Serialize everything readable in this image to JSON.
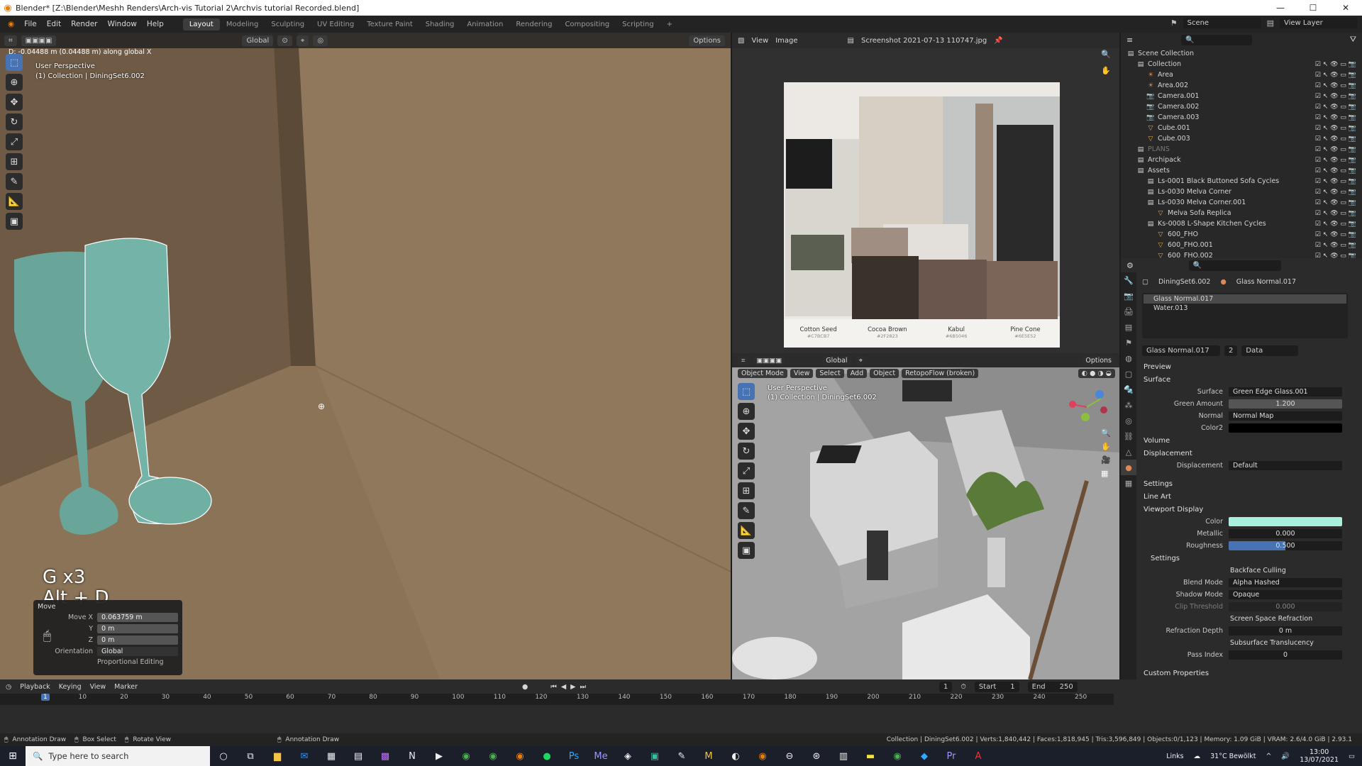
{
  "window": {
    "title": "Blender* [Z:\\Blender\\Meshh Renders\\Arch-vis Tutorial 2\\Archvis tutorial Recorded.blend]"
  },
  "menu": [
    "File",
    "Edit",
    "Render",
    "Window",
    "Help"
  ],
  "workspaces": [
    "Layout",
    "Modeling",
    "Sculpting",
    "UV Editing",
    "Texture Paint",
    "Shading",
    "Animation",
    "Rendering",
    "Compositing",
    "Scripting"
  ],
  "active_workspace": "Layout",
  "scene": "Scene",
  "view_layer": "View Layer",
  "viewport": {
    "header_status": "D: -0.04488 m (0.04488 m) along global X",
    "orientation": "Global",
    "options_label": "Options",
    "perspective": "User Perspective",
    "collection": "(1) Collection | DiningSet6.002",
    "keys_line1": "G x3",
    "keys_line2": "Alt + D"
  },
  "move_panel": {
    "title": "Move",
    "rows": [
      {
        "label": "Move X",
        "value": "0.063759 m"
      },
      {
        "label": "Y",
        "value": "0 m"
      },
      {
        "label": "Z",
        "value": "0 m"
      }
    ],
    "orientation_label": "Orientation",
    "orientation_value": "Global",
    "proportional": "Proportional Editing"
  },
  "image_editor": {
    "view": "View",
    "image": "Image",
    "filename": "Screenshot 2021-07-13 110747.jpg",
    "swatches": [
      {
        "name": "Cotton Seed",
        "code": "#C7BCB7",
        "color": "#5a5f52"
      },
      {
        "name": "Cocoa Brown",
        "code": "#2F2823",
        "color": "#3a312b"
      },
      {
        "name": "Kabul",
        "code": "#6B5046",
        "color": "#6b564d"
      },
      {
        "name": "Pine Cone",
        "code": "#6E5E52",
        "color": "#7a6558"
      }
    ]
  },
  "viewport2": {
    "mode": "Object Mode",
    "menus": [
      "View",
      "Select",
      "Add",
      "Object"
    ],
    "addon": "RetopoFlow (broken)",
    "orientation": "Global",
    "options_label": "Options",
    "perspective": "User Perspective",
    "collection": "(1) Collection | DiningSet6.002"
  },
  "outliner": {
    "root": "Scene Collection",
    "items": [
      {
        "name": "Collection",
        "icon": "collection-icon",
        "indent": 1,
        "dim": false
      },
      {
        "name": "Area",
        "icon": "light-icon",
        "indent": 2,
        "dim": false
      },
      {
        "name": "Area.002",
        "icon": "light-icon",
        "indent": 2,
        "dim": false
      },
      {
        "name": "Camera.001",
        "icon": "camera-icon",
        "indent": 2,
        "dim": false
      },
      {
        "name": "Camera.002",
        "icon": "camera-icon",
        "indent": 2,
        "dim": false
      },
      {
        "name": "Camera.003",
        "icon": "camera-icon",
        "indent": 2,
        "dim": false
      },
      {
        "name": "Cube.001",
        "icon": "mesh-icon",
        "indent": 2,
        "dim": false
      },
      {
        "name": "Cube.003",
        "icon": "mesh-icon",
        "indent": 2,
        "dim": false
      },
      {
        "name": "PLANS",
        "icon": "collection-icon",
        "indent": 1,
        "dim": true
      },
      {
        "name": "Archipack",
        "icon": "collection-icon",
        "indent": 1,
        "dim": false
      },
      {
        "name": "Assets",
        "icon": "collection-icon",
        "indent": 1,
        "dim": false
      },
      {
        "name": "Ls-0001 Black Buttoned Sofa Cycles",
        "icon": "collection-icon",
        "indent": 2,
        "dim": false
      },
      {
        "name": "Ls-0030 Melva Corner",
        "icon": "collection-icon",
        "indent": 2,
        "dim": false
      },
      {
        "name": "Ls-0030 Melva Corner.001",
        "icon": "collection-icon",
        "indent": 2,
        "dim": false
      },
      {
        "name": "Melva Sofa Replica",
        "icon": "mesh-icon",
        "indent": 3,
        "dim": false
      },
      {
        "name": "Ks-0008 L-Shape Kitchen Cycles",
        "icon": "collection-icon",
        "indent": 2,
        "dim": false
      },
      {
        "name": "600_FHO",
        "icon": "mesh-icon",
        "indent": 3,
        "dim": false
      },
      {
        "name": "600_FHO.001",
        "icon": "mesh-icon",
        "indent": 3,
        "dim": false
      },
      {
        "name": "600_FHO.002",
        "icon": "mesh-icon",
        "indent": 3,
        "dim": false
      }
    ]
  },
  "properties": {
    "object": "DiningSet6.002",
    "material": "Glass Normal.017",
    "slots": [
      "Glass Normal.017",
      "Water.013"
    ],
    "material_users": "2",
    "data_label": "Data",
    "sections": {
      "preview": "Preview",
      "surface": "Surface",
      "volume": "Volume",
      "displacement": "Displacement",
      "settings": "Settings",
      "line_art": "Line Art",
      "viewport_display": "Viewport Display",
      "settings_sub": "Settings",
      "custom_props": "Custom Properties"
    },
    "surface_rows": [
      {
        "label": "Surface",
        "value": "Green Edge Glass.001"
      },
      {
        "label": "Green Amount",
        "value": "1.200"
      },
      {
        "label": "Normal",
        "value": "Normal Map"
      },
      {
        "label": "Color2",
        "value": ""
      }
    ],
    "displacement_row": {
      "label": "Displacement",
      "value": "Default"
    },
    "viewport_rows": [
      {
        "label": "Color",
        "value": ""
      },
      {
        "label": "Metallic",
        "value": "0.000"
      },
      {
        "label": "Roughness",
        "value": "0.500"
      }
    ],
    "settings_rows": [
      {
        "label": "",
        "value": "Backface Culling"
      },
      {
        "label": "Blend Mode",
        "value": "Alpha Hashed"
      },
      {
        "label": "Shadow Mode",
        "value": "Opaque"
      },
      {
        "label": "Clip Threshold",
        "value": "0.000"
      },
      {
        "label": "",
        "value": "Screen Space Refraction"
      },
      {
        "label": "Refraction Depth",
        "value": "0 m"
      },
      {
        "label": "",
        "value": "Subsurface Translucency"
      },
      {
        "label": "Pass Index",
        "value": "0"
      }
    ],
    "viewport_color": "#a8f0dd",
    "roughness_fraction": 0.5
  },
  "timeline": {
    "menus": [
      "Playback",
      "Keying",
      "View",
      "Marker"
    ],
    "current_frame": "1",
    "start_label": "Start",
    "start": "1",
    "end_label": "End",
    "end": "250",
    "ticks": [
      "1",
      "10",
      "20",
      "30",
      "40",
      "50",
      "60",
      "70",
      "80",
      "90",
      "100",
      "110",
      "120",
      "130",
      "140",
      "150",
      "160",
      "170",
      "180",
      "190",
      "200",
      "210",
      "220",
      "230",
      "240",
      "250"
    ]
  },
  "statusbar": {
    "left": [
      "Annotation Draw",
      "Box Select",
      "Rotate View"
    ],
    "mid": "Annotation Draw",
    "right": "Collection | DiningSet6.002 | Verts:1,840,442 | Faces:1,818,945 | Tris:3,596,849 | Objects:0/1,123 | Memory: 1.09 GiB | VRAM: 2.6/4.0 GiB | 2.93.1"
  },
  "taskbar": {
    "search": "Type here to search",
    "links": "Links",
    "weather": "31°C  Bewölkt",
    "time": "13:00",
    "date": "13/07/2021"
  }
}
